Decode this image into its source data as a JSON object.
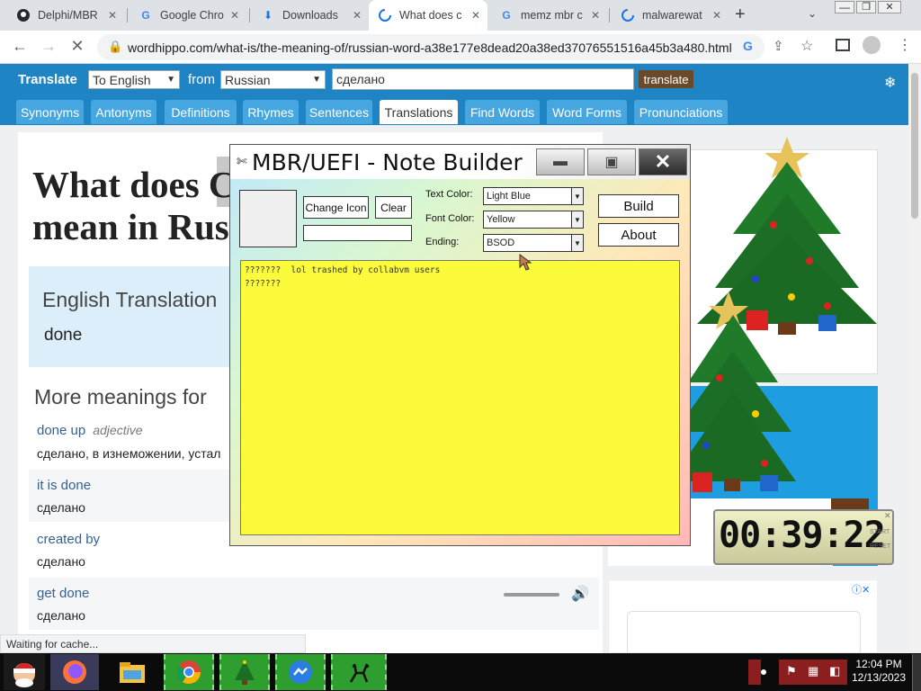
{
  "browser": {
    "tabs": [
      {
        "icon": "github-icon",
        "label": "Delphi/MBR"
      },
      {
        "icon": "google-icon",
        "label": "Google Chro"
      },
      {
        "icon": "download-icon",
        "label": "Downloads"
      },
      {
        "icon": "loading-spinner-icon",
        "label": "What does c"
      },
      {
        "icon": "google-icon",
        "label": "memz mbr c"
      },
      {
        "icon": "loading-spinner-icon",
        "label": "malwarewat"
      }
    ],
    "new_tab": "+",
    "url": "wordhippo.com/what-is/the-meaning-of/russian-word-a38e177e8dead20a38ed37076551516a45b3a480.html"
  },
  "site": {
    "translate_label": "Translate",
    "to_select": "To English",
    "from_label": "from",
    "from_select": "Russian",
    "query": "сделано",
    "translate_button": "translate",
    "nav": [
      "Synonyms",
      "Antonyms",
      "Definitions",
      "Rhymes",
      "Sentences",
      "Translations",
      "Find Words",
      "Word Forms",
      "Pronunciations"
    ],
    "heading_line1": "What does С",
    "heading_line2": "mean in Rus",
    "translation_title": "English Translation",
    "translation_value": "done",
    "more_title": "More meanings for",
    "meanings": [
      {
        "word": "done up",
        "type": "adjective",
        "trans": "сделано, в изнеможении, устал"
      },
      {
        "word": "it is done",
        "type": "",
        "trans": "сделано"
      },
      {
        "word": "created by",
        "type": "",
        "trans": "сделано"
      },
      {
        "word": "get done",
        "type": "",
        "trans": "сделано"
      }
    ]
  },
  "status_bar": "Waiting for cache...",
  "note_builder": {
    "title": "MBR/UEFI - Note Builder",
    "change_icon": "Change Icon",
    "clear": "Clear",
    "text_color_label": "Text Color:",
    "text_color_value": "Light Blue",
    "font_color_label": "Font Color:",
    "font_color_value": "Yellow",
    "ending_label": "Ending:",
    "ending_value": "BSOD",
    "build": "Build",
    "about": "About",
    "note_text": "???????  lol trashed by collabvm users\n???????"
  },
  "clock_widget": {
    "time": "00:39:22",
    "side_labels": [
      "START",
      "RESET"
    ]
  },
  "taskbar": {
    "time": "12:04 PM",
    "date": "12/13/2023",
    "icons": [
      "santa-icon",
      "firefox-icon",
      "file-explorer-icon",
      "chrome-icon",
      "christmas-tree-icon",
      "messenger-icon",
      "reindeer-icon"
    ]
  },
  "colors": {
    "site_blue": "#1f84c4",
    "nav_blue": "#46a6e0",
    "note_yellow": "#fbfb3c",
    "translate_btn": "#6a4a2a"
  }
}
